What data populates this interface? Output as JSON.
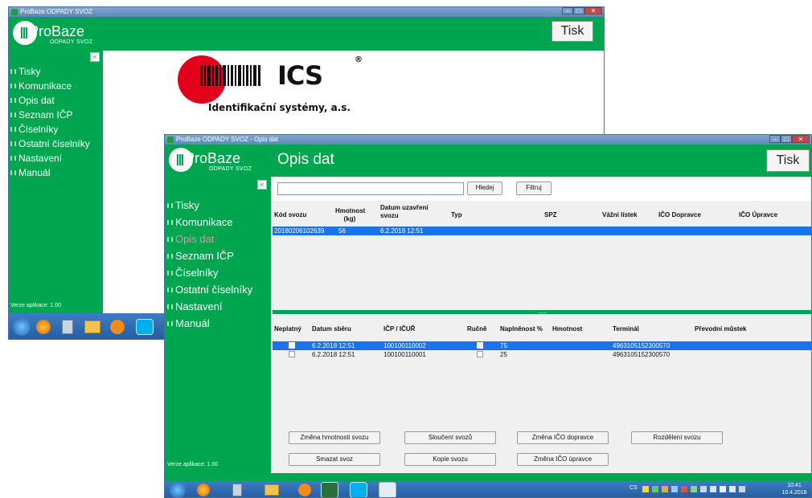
{
  "back_window": {
    "title": "ProBaze ODPADY SVOZ",
    "app_name": "ProBaze",
    "app_sub": "ODPADY SVOZ",
    "tisk_label": "Tisk",
    "collapse_label": "«",
    "nav": [
      "Tisky",
      "Komunikace",
      "Opis dat",
      "Seznam IČP",
      "Číselníky",
      "Ostatní číselníky",
      "Nastavení",
      "Manuál"
    ],
    "version": "Verze aplikace: 1.00",
    "ics_text": "ICS",
    "ics_registered": "®",
    "ics_company": "Identifikační systémy, a.s."
  },
  "front_window": {
    "title": "ProBaze ODPADY SVOZ - Opis dat",
    "app_name": "ProBaze",
    "app_sub": "ODPADY SVOZ",
    "page_title": "Opis dat",
    "tisk_label": "Tisk",
    "collapse_label": "«",
    "nav": [
      "Tisky",
      "Komunikace",
      "Opis dat",
      "Seznam IČP",
      "Číselníky",
      "Ostatní číselníky",
      "Nastavení",
      "Manuál"
    ],
    "active_nav": "Opis dat",
    "version": "Verze aplikace: 1.00",
    "search": {
      "value": "",
      "hledej_label": "Hledej",
      "filtruj_label": "Filtruj"
    },
    "upper_grid": {
      "columns": [
        "Kód svozu",
        "Hmotnost (kg)",
        "Datum uzavření svozu",
        "Typ",
        "SPZ",
        "Vážní lístek",
        "IČO Dopravce",
        "IČO Úpravce"
      ],
      "rows": [
        {
          "kod": "20180206102639",
          "hmotnost": "56",
          "datum": "6.2.2018 12:51",
          "typ": "",
          "spz": "",
          "listek": "",
          "ico_dopravce": "",
          "ico_upravce": ""
        }
      ]
    },
    "splitter_label": ".....",
    "lower_grid": {
      "columns": [
        "Neplatný",
        "Datum sběru",
        "IČP / IČUŘ",
        "Ručně",
        "Naplněnost %",
        "Hmotnost",
        "Terminál",
        "Převodní můstek"
      ],
      "rows": [
        {
          "neplatny": false,
          "datum": "6.2.2018 12:51",
          "icp": "100100110002",
          "rucne": true,
          "naplnenost": "75",
          "hmotnost": "",
          "terminal": "4963105152300570",
          "mustek": "",
          "selected": true
        },
        {
          "neplatny": false,
          "datum": "6.2.2018 12:51",
          "icp": "100100110001",
          "rucne": false,
          "naplnenost": "25",
          "hmotnost": "",
          "terminal": "4963105152300570",
          "mustek": "",
          "selected": false
        }
      ]
    },
    "buttons": {
      "zmena_hmotnosti": "Změna hmotnosti svozu",
      "slouceni": "Sloučení svozů",
      "zmena_ico_dopravce": "Změna IČO dopravce",
      "rozdeleni": "Rozdělení svozu",
      "smazat": "Smazat svoz",
      "kopie": "Kopie svozu",
      "zmena_ico_upravce": "Změna IČO úpravce"
    }
  },
  "taskbar": {
    "lang": "CS",
    "time": "10:41",
    "date": "10.4.2018"
  },
  "colors": {
    "green": "#00a64f",
    "selection": "#1a73e8",
    "active_nav": "#e88e9b",
    "ics_red": "#e3001b"
  }
}
